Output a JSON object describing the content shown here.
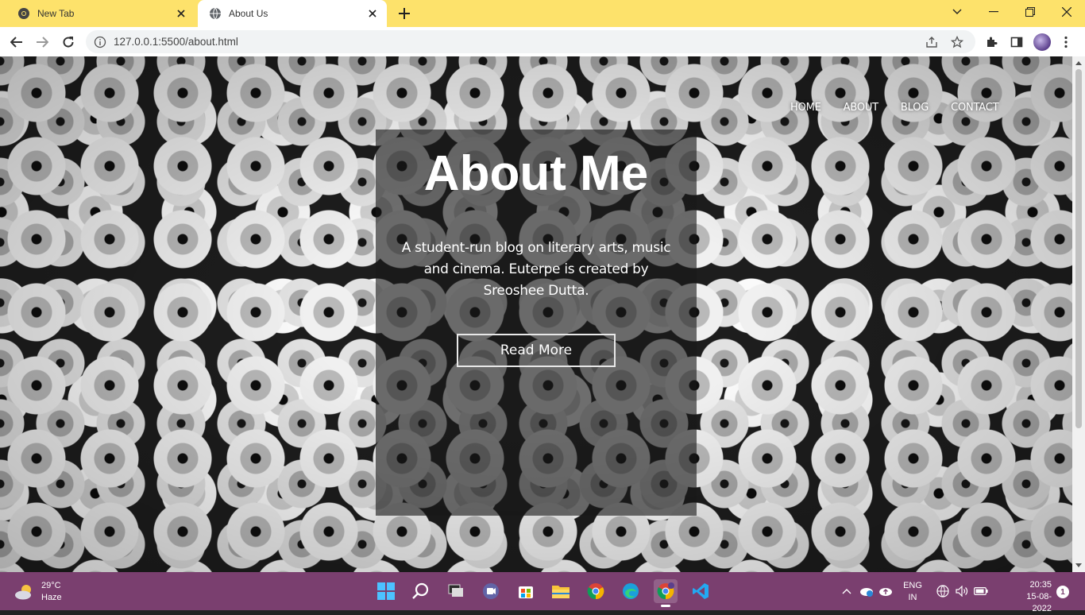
{
  "browser": {
    "tabs": [
      {
        "title": "New Tab"
      },
      {
        "title": "About Us"
      }
    ],
    "url": "127.0.0.1:5500/about.html",
    "accent": "#fde26b"
  },
  "site": {
    "nav": [
      "HOME",
      "ABOUT",
      "BLOG",
      "CONTACT"
    ],
    "heading": "About Me",
    "description": "A student-run blog on literary arts, music and cinema. Euterpe is created by Sreoshee Dutta.",
    "cta": "Read More"
  },
  "taskbar": {
    "weather_temp": "29°C",
    "weather_cond": "Haze",
    "lang_1": "ENG",
    "lang_2": "IN",
    "time": "20:35",
    "date": "15-08-2022",
    "notifications": "1",
    "color": "#7a3f6f"
  }
}
